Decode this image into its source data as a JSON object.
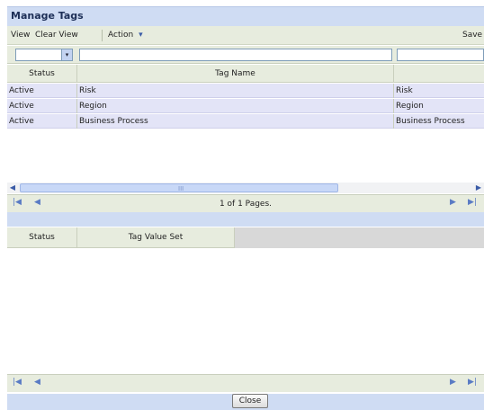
{
  "window": {
    "title": "Manage Tags"
  },
  "toolbar": {
    "view": "View",
    "clear_view": "Clear View",
    "action": "Action",
    "action_arrow": "▾",
    "save": "Save"
  },
  "filter": {
    "select_arrow": "▾"
  },
  "grid1": {
    "columns": [
      "Status",
      "Tag Name"
    ],
    "rows": [
      {
        "status": "Active",
        "tag_name": "Risk",
        "extra": "Risk"
      },
      {
        "status": "Active",
        "tag_name": "Region",
        "extra": "Region"
      },
      {
        "status": "Active",
        "tag_name": "Business Process",
        "extra": "Business Process"
      }
    ],
    "pager_text": "1 of 1 Pages.",
    "grip": "III"
  },
  "grid2": {
    "columns": [
      "Status",
      "Tag Value Set"
    ]
  },
  "footer": {
    "close": "Close"
  },
  "icons": {
    "first": "|◀",
    "prev": "◀",
    "next": "▶",
    "last": "▶|",
    "scroll_left": "◀",
    "scroll_right": "▶"
  },
  "colors": {
    "title_bar": "#cfdcf3",
    "toolbar": "#e7ecde",
    "row_bg": "#e3e4f7"
  }
}
